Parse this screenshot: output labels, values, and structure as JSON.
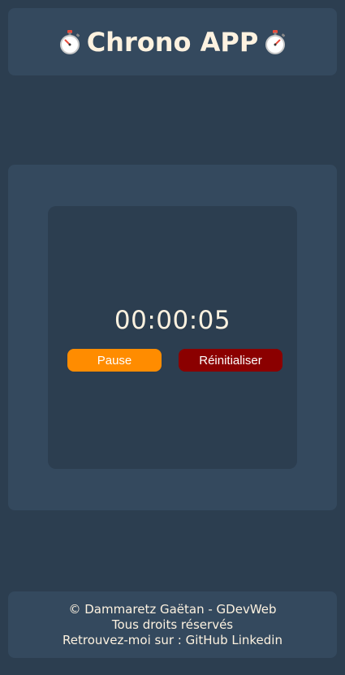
{
  "header": {
    "title": "Chrono APP",
    "left_icon": "stopwatch-icon",
    "right_icon": "stopwatch-icon"
  },
  "timer": {
    "display": "00:00:05"
  },
  "controls": {
    "pause_label": "Pause",
    "reset_label": "Réinitialiser",
    "pause_color": "#ff8c00",
    "reset_color": "#8b0000"
  },
  "footer": {
    "copyright": "© Dammaretz Gaëtan - GDevWeb",
    "rights": "Tous droits réservés",
    "find_me_prefix": "Retrouvez-moi sur :",
    "github_label": "GitHub",
    "linkedin_label": "Linkedin"
  },
  "colors": {
    "background": "#2c3e50",
    "panel": "#34495e",
    "text": "#fdf2e0"
  }
}
